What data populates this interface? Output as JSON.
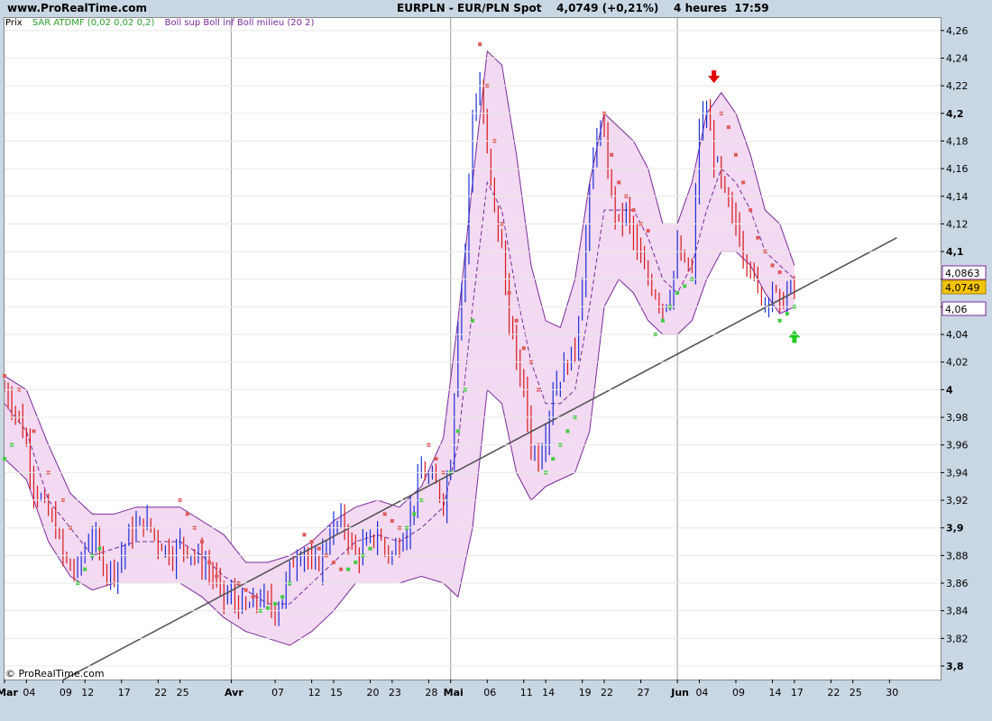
{
  "header": {
    "site": "www.ProRealTime.com",
    "instrument": "EURPLN - EUR/PLN Spot",
    "price": "4,0749",
    "change": "(+0,21%)",
    "timeframe": "4 heures",
    "time": "17:59"
  },
  "legend": {
    "price_label": "Prix",
    "sar_label": "SAR ATDMF (0,02 0,02 0,2)",
    "boll_label": "Boll sup Boll inf Boll milieu (20 2)"
  },
  "copyright": "© ProRealTime.com",
  "colors": {
    "up": "#1a2fd6",
    "down": "#d61a1a",
    "sar_bear": "#e05a5a",
    "sar_bull": "#44cc44",
    "band_fill": "#f3d9f1",
    "band_line": "#7a2a9a",
    "trendline": "#555555",
    "price_box": "#f5c400"
  },
  "chart_data": {
    "type": "line",
    "y_axis": {
      "range": [
        3.8,
        4.26
      ],
      "ticks": [
        "3,8",
        "3,82",
        "3,84",
        "3,86",
        "3,88",
        "3,9",
        "3,92",
        "3,94",
        "3,96",
        "3,98",
        "4",
        "4,02",
        "4,04",
        "4,06",
        "4,08",
        "4,1",
        "4,12",
        "4,14",
        "4,16",
        "4,18",
        "4,2",
        "4,22",
        "4,24",
        "4,26"
      ],
      "tick_values": [
        3.8,
        3.82,
        3.84,
        3.86,
        3.88,
        3.9,
        3.92,
        3.94,
        3.96,
        3.98,
        4.0,
        4.02,
        4.04,
        4.06,
        4.08,
        4.1,
        4.12,
        4.14,
        4.16,
        4.18,
        4.2,
        4.22,
        4.24,
        4.26
      ],
      "bold_ticks": [
        "3,8",
        "3,9",
        "4",
        "4,1",
        "4,2"
      ]
    },
    "x_axis": {
      "labels": [
        "Mar",
        "04",
        "09",
        "12",
        "17",
        "22",
        "25",
        "Avr",
        "07",
        "12",
        "15",
        "20",
        "23",
        "28",
        "Mai",
        "06",
        "11",
        "14",
        "19",
        "22",
        "27",
        "Jun",
        "04",
        "09",
        "14",
        "17",
        "22",
        "25",
        "30"
      ],
      "day_index": [
        0,
        3,
        8,
        11,
        16,
        21,
        24,
        31,
        37,
        42,
        45,
        50,
        53,
        58,
        61,
        66,
        71,
        74,
        79,
        82,
        87,
        92,
        95,
        100,
        105,
        108,
        113,
        116,
        121
      ],
      "month_separators": [
        0,
        31,
        61,
        92
      ],
      "day_range": [
        0,
        122
      ]
    },
    "price_labels": {
      "bollinger_upper": "4,0863",
      "last_price": "4,0749",
      "bollinger_lower": "4,06"
    },
    "middle_band": [
      [
        0,
        3.99
      ],
      [
        3,
        3.97
      ],
      [
        6,
        3.92
      ],
      [
        9,
        3.9
      ],
      [
        12,
        3.88
      ],
      [
        15,
        3.885
      ],
      [
        18,
        3.89
      ],
      [
        21,
        3.89
      ],
      [
        24,
        3.89
      ],
      [
        27,
        3.88
      ],
      [
        30,
        3.865
      ],
      [
        33,
        3.855
      ],
      [
        36,
        3.845
      ],
      [
        39,
        3.845
      ],
      [
        42,
        3.86
      ],
      [
        45,
        3.875
      ],
      [
        48,
        3.89
      ],
      [
        51,
        3.895
      ],
      [
        54,
        3.89
      ],
      [
        57,
        3.9
      ],
      [
        60,
        3.915
      ],
      [
        62,
        3.96
      ],
      [
        64,
        4.06
      ],
      [
        66,
        4.15
      ],
      [
        68,
        4.13
      ],
      [
        70,
        4.07
      ],
      [
        72,
        4.02
      ],
      [
        74,
        3.99
      ],
      [
        76,
        3.99
      ],
      [
        78,
        4.0
      ],
      [
        80,
        4.06
      ],
      [
        82,
        4.13
      ],
      [
        84,
        4.13
      ],
      [
        86,
        4.13
      ],
      [
        88,
        4.11
      ],
      [
        90,
        4.08
      ],
      [
        92,
        4.07
      ],
      [
        94,
        4.09
      ],
      [
        96,
        4.13
      ],
      [
        98,
        4.16
      ],
      [
        100,
        4.15
      ],
      [
        102,
        4.13
      ],
      [
        104,
        4.1
      ],
      [
        106,
        4.09
      ],
      [
        108,
        4.08
      ]
    ],
    "upper_band": [
      [
        0,
        4.01
      ],
      [
        3,
        4.0
      ],
      [
        6,
        3.96
      ],
      [
        9,
        3.925
      ],
      [
        12,
        3.91
      ],
      [
        15,
        3.91
      ],
      [
        18,
        3.915
      ],
      [
        21,
        3.915
      ],
      [
        24,
        3.915
      ],
      [
        27,
        3.905
      ],
      [
        30,
        3.895
      ],
      [
        33,
        3.875
      ],
      [
        36,
        3.875
      ],
      [
        39,
        3.88
      ],
      [
        42,
        3.89
      ],
      [
        45,
        3.905
      ],
      [
        48,
        3.915
      ],
      [
        51,
        3.92
      ],
      [
        54,
        3.915
      ],
      [
        57,
        3.93
      ],
      [
        60,
        3.965
      ],
      [
        62,
        4.05
      ],
      [
        64,
        4.15
      ],
      [
        66,
        4.245
      ],
      [
        68,
        4.235
      ],
      [
        70,
        4.17
      ],
      [
        72,
        4.09
      ],
      [
        74,
        4.05
      ],
      [
        76,
        4.045
      ],
      [
        78,
        4.08
      ],
      [
        80,
        4.15
      ],
      [
        82,
        4.2
      ],
      [
        84,
        4.19
      ],
      [
        86,
        4.18
      ],
      [
        88,
        4.16
      ],
      [
        90,
        4.12
      ],
      [
        92,
        4.12
      ],
      [
        94,
        4.15
      ],
      [
        96,
        4.2
      ],
      [
        98,
        4.215
      ],
      [
        100,
        4.2
      ],
      [
        102,
        4.17
      ],
      [
        104,
        4.13
      ],
      [
        106,
        4.12
      ],
      [
        108,
        4.09
      ]
    ],
    "lower_band": [
      [
        0,
        3.95
      ],
      [
        3,
        3.935
      ],
      [
        6,
        3.89
      ],
      [
        9,
        3.865
      ],
      [
        12,
        3.855
      ],
      [
        15,
        3.86
      ],
      [
        18,
        3.86
      ],
      [
        21,
        3.86
      ],
      [
        24,
        3.86
      ],
      [
        27,
        3.85
      ],
      [
        30,
        3.835
      ],
      [
        33,
        3.825
      ],
      [
        36,
        3.82
      ],
      [
        39,
        3.815
      ],
      [
        42,
        3.825
      ],
      [
        45,
        3.84
      ],
      [
        48,
        3.86
      ],
      [
        51,
        3.86
      ],
      [
        54,
        3.86
      ],
      [
        57,
        3.865
      ],
      [
        60,
        3.86
      ],
      [
        62,
        3.85
      ],
      [
        64,
        3.9
      ],
      [
        66,
        4.0
      ],
      [
        68,
        3.99
      ],
      [
        70,
        3.94
      ],
      [
        72,
        3.92
      ],
      [
        74,
        3.93
      ],
      [
        76,
        3.935
      ],
      [
        78,
        3.94
      ],
      [
        80,
        3.97
      ],
      [
        82,
        4.06
      ],
      [
        84,
        4.08
      ],
      [
        86,
        4.07
      ],
      [
        88,
        4.05
      ],
      [
        90,
        4.04
      ],
      [
        92,
        4.04
      ],
      [
        94,
        4.05
      ],
      [
        96,
        4.08
      ],
      [
        98,
        4.1
      ],
      [
        100,
        4.1
      ],
      [
        102,
        4.09
      ],
      [
        104,
        4.07
      ],
      [
        106,
        4.055
      ],
      [
        108,
        4.06
      ]
    ],
    "close": [
      [
        0,
        4.0
      ],
      [
        1,
        3.99
      ],
      [
        2,
        3.98
      ],
      [
        3,
        3.96
      ],
      [
        4,
        3.93
      ],
      [
        5,
        3.92
      ],
      [
        6,
        3.91
      ],
      [
        7,
        3.9
      ],
      [
        8,
        3.88
      ],
      [
        9,
        3.87
      ],
      [
        10,
        3.87
      ],
      [
        11,
        3.885
      ],
      [
        12,
        3.895
      ],
      [
        13,
        3.88
      ],
      [
        14,
        3.87
      ],
      [
        15,
        3.87
      ],
      [
        16,
        3.88
      ],
      [
        17,
        3.895
      ],
      [
        18,
        3.9
      ],
      [
        19,
        3.905
      ],
      [
        20,
        3.9
      ],
      [
        21,
        3.89
      ],
      [
        22,
        3.885
      ],
      [
        23,
        3.88
      ],
      [
        24,
        3.89
      ],
      [
        25,
        3.885
      ],
      [
        26,
        3.88
      ],
      [
        27,
        3.875
      ],
      [
        28,
        3.87
      ],
      [
        29,
        3.86
      ],
      [
        30,
        3.85
      ],
      [
        31,
        3.85
      ],
      [
        32,
        3.845
      ],
      [
        33,
        3.84
      ],
      [
        34,
        3.845
      ],
      [
        35,
        3.85
      ],
      [
        36,
        3.845
      ],
      [
        37,
        3.84
      ],
      [
        38,
        3.85
      ],
      [
        39,
        3.87
      ],
      [
        40,
        3.88
      ],
      [
        41,
        3.885
      ],
      [
        42,
        3.87
      ],
      [
        43,
        3.875
      ],
      [
        44,
        3.89
      ],
      [
        45,
        3.9
      ],
      [
        46,
        3.905
      ],
      [
        47,
        3.895
      ],
      [
        48,
        3.88
      ],
      [
        49,
        3.885
      ],
      [
        50,
        3.89
      ],
      [
        51,
        3.895
      ],
      [
        52,
        3.885
      ],
      [
        53,
        3.88
      ],
      [
        54,
        3.89
      ],
      [
        55,
        3.9
      ],
      [
        56,
        3.92
      ],
      [
        57,
        3.94
      ],
      [
        58,
        3.935
      ],
      [
        59,
        3.93
      ],
      [
        60,
        3.92
      ],
      [
        61,
        3.95
      ],
      [
        62,
        4.05
      ],
      [
        63,
        4.1
      ],
      [
        64,
        4.2
      ],
      [
        65,
        4.22
      ],
      [
        66,
        4.17
      ],
      [
        67,
        4.13
      ],
      [
        68,
        4.1
      ],
      [
        69,
        4.05
      ],
      [
        70,
        4.02
      ],
      [
        71,
        4.0
      ],
      [
        72,
        3.96
      ],
      [
        73,
        3.95
      ],
      [
        74,
        3.97
      ],
      [
        75,
        4.0
      ],
      [
        76,
        4.01
      ],
      [
        77,
        4.02
      ],
      [
        78,
        4.03
      ],
      [
        79,
        4.08
      ],
      [
        80,
        4.14
      ],
      [
        81,
        4.19
      ],
      [
        82,
        4.18
      ],
      [
        83,
        4.14
      ],
      [
        84,
        4.12
      ],
      [
        85,
        4.13
      ],
      [
        86,
        4.11
      ],
      [
        87,
        4.09
      ],
      [
        88,
        4.08
      ],
      [
        89,
        4.07
      ],
      [
        90,
        4.06
      ],
      [
        91,
        4.07
      ],
      [
        92,
        4.1
      ],
      [
        93,
        4.09
      ],
      [
        94,
        4.085
      ],
      [
        95,
        4.19
      ],
      [
        96,
        4.2
      ],
      [
        97,
        4.17
      ],
      [
        98,
        4.15
      ],
      [
        99,
        4.13
      ],
      [
        100,
        4.12
      ],
      [
        101,
        4.1
      ],
      [
        102,
        4.09
      ],
      [
        103,
        4.07
      ],
      [
        104,
        4.065
      ],
      [
        105,
        4.075
      ],
      [
        106,
        4.06
      ],
      [
        107,
        4.07
      ],
      [
        108,
        4.075
      ]
    ],
    "sar_bear": [
      [
        0,
        4.01
      ],
      [
        2,
        4.0
      ],
      [
        4,
        3.97
      ],
      [
        6,
        3.94
      ],
      [
        8,
        3.92
      ],
      [
        9,
        3.9
      ],
      [
        24,
        3.92
      ],
      [
        25,
        3.91
      ],
      [
        26,
        3.9
      ],
      [
        27,
        3.89
      ],
      [
        28,
        3.875
      ],
      [
        29,
        3.865
      ],
      [
        32,
        3.86
      ],
      [
        33,
        3.855
      ],
      [
        34,
        3.85
      ],
      [
        41,
        3.895
      ],
      [
        42,
        3.89
      ],
      [
        43,
        3.885
      ],
      [
        44,
        3.88
      ],
      [
        45,
        3.875
      ],
      [
        46,
        3.87
      ],
      [
        52,
        3.91
      ],
      [
        53,
        3.905
      ],
      [
        54,
        3.9
      ],
      [
        58,
        3.96
      ],
      [
        59,
        3.95
      ],
      [
        60,
        3.94
      ],
      [
        65,
        4.25
      ],
      [
        66,
        4.22
      ],
      [
        67,
        4.18
      ],
      [
        68,
        4.12
      ],
      [
        69,
        4.07
      ],
      [
        70,
        4.05
      ],
      [
        71,
        4.03
      ],
      [
        72,
        4.02
      ],
      [
        73,
        4.0
      ],
      [
        82,
        4.2
      ],
      [
        83,
        4.17
      ],
      [
        84,
        4.15
      ],
      [
        85,
        4.14
      ],
      [
        86,
        4.13
      ],
      [
        87,
        4.12
      ],
      [
        88,
        4.115
      ],
      [
        98,
        4.2
      ],
      [
        99,
        4.19
      ],
      [
        100,
        4.17
      ],
      [
        101,
        4.15
      ],
      [
        102,
        4.13
      ],
      [
        103,
        4.11
      ],
      [
        104,
        4.1
      ],
      [
        105,
        4.09
      ],
      [
        106,
        4.085
      ]
    ],
    "sar_bull": [
      [
        0,
        3.95
      ],
      [
        1,
        3.96
      ],
      [
        10,
        3.86
      ],
      [
        11,
        3.87
      ],
      [
        12,
        3.88
      ],
      [
        13,
        3.885
      ],
      [
        35,
        3.84
      ],
      [
        36,
        3.842
      ],
      [
        37,
        3.845
      ],
      [
        38,
        3.85
      ],
      [
        39,
        3.86
      ],
      [
        47,
        3.87
      ],
      [
        48,
        3.875
      ],
      [
        49,
        3.88
      ],
      [
        50,
        3.885
      ],
      [
        55,
        3.9
      ],
      [
        56,
        3.91
      ],
      [
        57,
        3.92
      ],
      [
        61,
        3.94
      ],
      [
        62,
        3.97
      ],
      [
        63,
        4.0
      ],
      [
        64,
        4.05
      ],
      [
        74,
        3.94
      ],
      [
        75,
        3.95
      ],
      [
        76,
        3.96
      ],
      [
        77,
        3.97
      ],
      [
        78,
        3.98
      ],
      [
        89,
        4.04
      ],
      [
        90,
        4.05
      ],
      [
        91,
        4.06
      ],
      [
        92,
        4.07
      ],
      [
        93,
        4.075
      ],
      [
        94,
        4.08
      ],
      [
        106,
        4.05
      ],
      [
        107,
        4.055
      ],
      [
        108,
        4.06
      ]
    ],
    "trendline": [
      [
        8,
        3.79
      ],
      [
        122,
        4.11
      ]
    ],
    "signals": [
      {
        "type": "sell",
        "day": 97,
        "value": 4.222
      },
      {
        "type": "buy",
        "day": 108,
        "value": 4.043
      }
    ]
  }
}
